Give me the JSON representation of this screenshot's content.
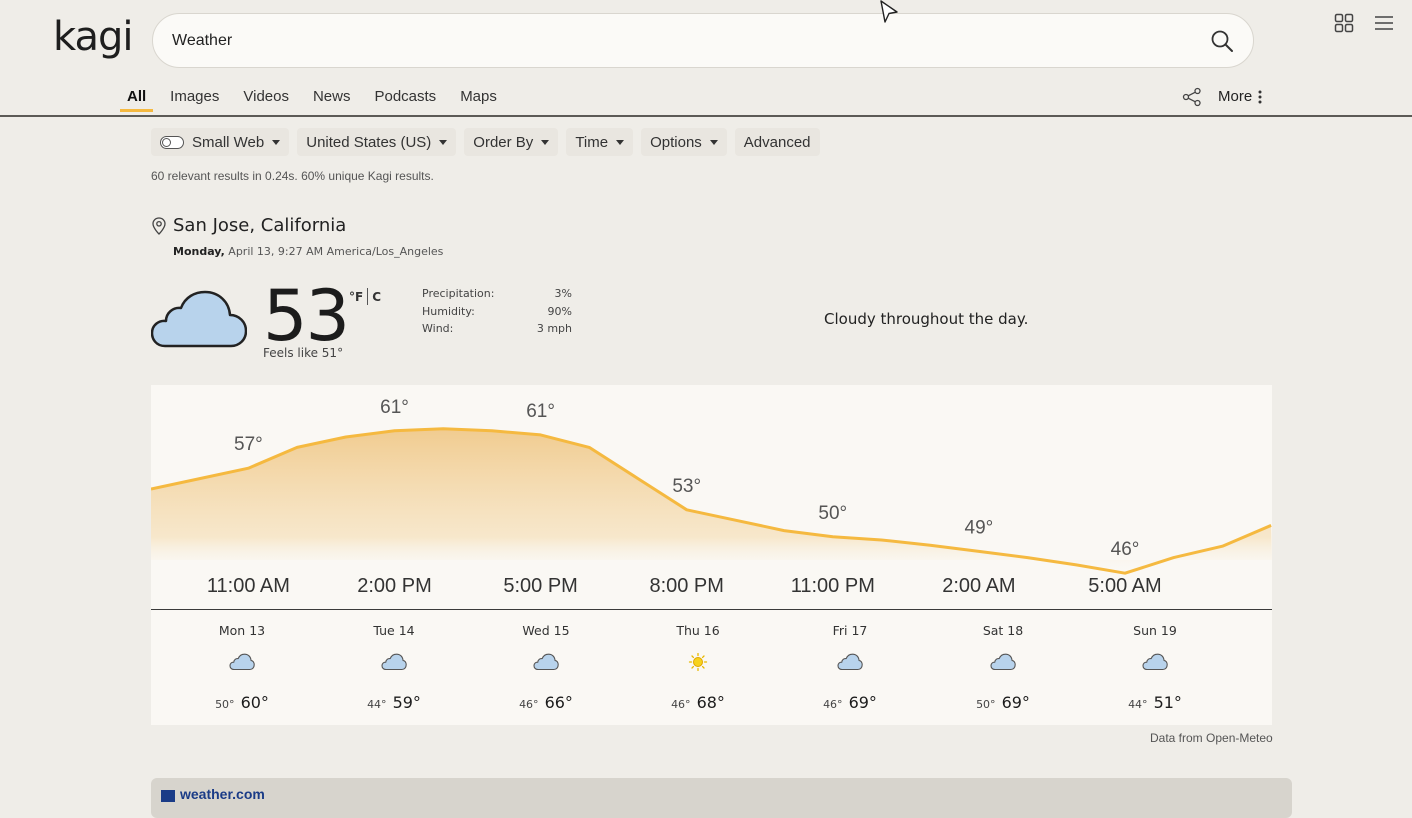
{
  "header": {
    "logo": "kagi",
    "search": {
      "value": "Weather",
      "placeholder": ""
    }
  },
  "tabs": [
    {
      "label": "All",
      "active": true
    },
    {
      "label": "Images"
    },
    {
      "label": "Videos"
    },
    {
      "label": "News"
    },
    {
      "label": "Podcasts"
    },
    {
      "label": "Maps"
    }
  ],
  "more_label": "More",
  "filters": {
    "small_web": "Small Web",
    "region": "United States (US)",
    "order_by": "Order By",
    "time": "Time",
    "options": "Options",
    "advanced": "Advanced"
  },
  "stats": "60 relevant results in 0.24s. 60% unique Kagi results.",
  "weather": {
    "location": "San Jose, California",
    "day": "Monday,",
    "datetime": "April 13, 9:27 AM America/Los_Angeles",
    "temperature": "53",
    "unit_f": "°F",
    "unit_c": "C",
    "feels_like": "Feels like 51°",
    "details": [
      {
        "label": "Precipitation:",
        "value": "3%"
      },
      {
        "label": "Humidity:",
        "value": "90%"
      },
      {
        "label": "Wind:",
        "value": "3 mph"
      }
    ],
    "summary": "Cloudy throughout the day.",
    "source": "Data from Open-Meteo",
    "accent_color": "#f5b940",
    "hourly_labels": [
      {
        "time": "11:00 AM",
        "temp": "57°"
      },
      {
        "time": "2:00 PM",
        "temp": "61°"
      },
      {
        "time": "5:00 PM",
        "temp": "61°"
      },
      {
        "time": "8:00 PM",
        "temp": "53°"
      },
      {
        "time": "11:00 PM",
        "temp": "50°"
      },
      {
        "time": "2:00 AM",
        "temp": "49°"
      },
      {
        "time": "5:00 AM",
        "temp": "46°"
      }
    ],
    "hourly_curve": [
      55,
      56,
      57,
      59,
      60,
      60.6,
      60.8,
      60.6,
      60.2,
      59,
      56,
      53,
      52,
      51,
      50.4,
      50.1,
      49.6,
      49,
      48.4,
      47.7,
      46.9,
      48.4,
      49.5,
      51.5
    ],
    "daily": [
      {
        "day": "Mon 13",
        "icon": "cloud-icon",
        "lo": "50°",
        "hi": "60°"
      },
      {
        "day": "Tue 14",
        "icon": "cloud-icon",
        "lo": "44°",
        "hi": "59°"
      },
      {
        "day": "Wed 15",
        "icon": "cloud-icon",
        "lo": "46°",
        "hi": "66°"
      },
      {
        "day": "Thu 16",
        "icon": "sun-icon",
        "lo": "46°",
        "hi": "68°"
      },
      {
        "day": "Fri 17",
        "icon": "cloud-icon",
        "lo": "46°",
        "hi": "69°"
      },
      {
        "day": "Sat 18",
        "icon": "cloud-icon",
        "lo": "50°",
        "hi": "69°"
      },
      {
        "day": "Sun 19",
        "icon": "cloud-icon",
        "lo": "44°",
        "hi": "51°"
      }
    ]
  },
  "next_result": {
    "title": "weather.com"
  }
}
